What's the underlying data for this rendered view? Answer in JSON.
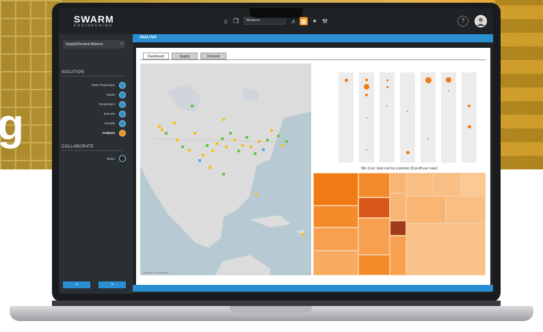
{
  "hero": {
    "heading_fragment": "g"
  },
  "app": {
    "logo": "SWARM",
    "logo_sub": "ENGINEERING",
    "toolbar": {
      "home_icon": "home-icon",
      "bookmark_icon": "bookmark-icon",
      "model_select": "Moderna",
      "chart_icon": "chart-icon",
      "grid_icon": "grid-icon",
      "wand_icon": "wand-icon",
      "wrench_icon": "wrench-icon",
      "help_label": "?"
    },
    "colors": {
      "accent": "#2a8fd2",
      "active": "#f0921f",
      "panel": "#1f2326"
    }
  },
  "sidebar": {
    "selector_label": "Supply/Demand Balance",
    "solution_heading": "SOLUTION",
    "solution_items": [
      {
        "label": "Data Preparation"
      },
      {
        "label": "Inputs"
      },
      {
        "label": "Parameters"
      },
      {
        "label": "Execute"
      },
      {
        "label": "Results"
      },
      {
        "label": "Analysis"
      }
    ],
    "collaborate_heading": "COLLABORATE",
    "collaborate_items": [
      {
        "label": "Share"
      }
    ],
    "prev_label": "<",
    "next_label": ">"
  },
  "main": {
    "section_title": "ANALYSIS",
    "tabs": [
      {
        "label": "Dashboard"
      },
      {
        "label": "Supply"
      },
      {
        "label": "Demand"
      }
    ],
    "map_credit": "© Mapbox © OpenStreetMap",
    "treemap_title": "Min Cost: total cost by customer ($ profit per case)"
  }
}
